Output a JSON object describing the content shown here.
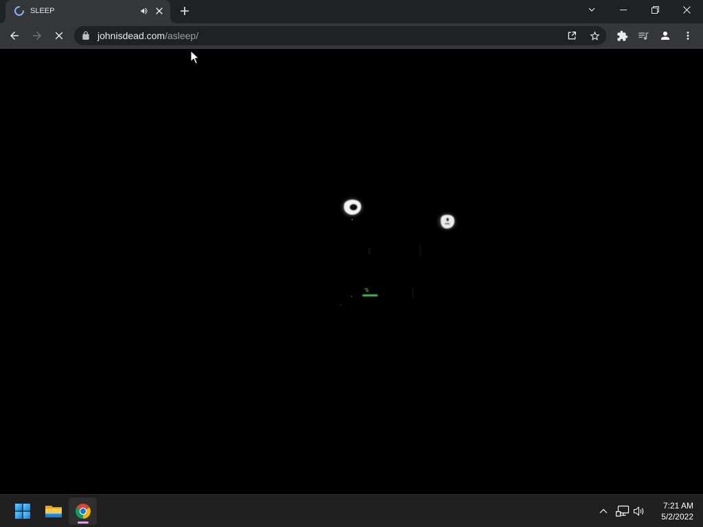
{
  "tabstrip": {
    "tabs": [
      {
        "title": "SLEEP",
        "active": true,
        "loading": true,
        "audio_playing": true,
        "icons": [
          "loading-spinner-icon",
          "audio-playing-icon",
          "close-icon"
        ]
      }
    ],
    "icons": [
      "new-tab-icon",
      "tab-search-icon",
      "minimize-icon",
      "restore-icon",
      "close-icon"
    ]
  },
  "toolbar": {
    "url": {
      "domain": "johnisdead.com",
      "path": "/asleep/"
    },
    "secure": true,
    "back_enabled": true,
    "forward_enabled": false,
    "page_loading": true,
    "icons": {
      "navigation": [
        "back-arrow-icon",
        "forward-arrow-icon",
        "stop-loading-icon"
      ],
      "omnibox": [
        "lock-icon",
        "share-icon",
        "star-icon"
      ],
      "actions": [
        "extensions-icon",
        "media-controls-icon",
        "profile-icon",
        "more-vert-icon"
      ]
    }
  },
  "taskbar": {
    "apps": [
      {
        "icon": "windows-start-icon",
        "running": false
      },
      {
        "icon": "file-explorer-icon",
        "running": false
      },
      {
        "icon": "chrome-icon",
        "running": true,
        "active": true
      }
    ],
    "tray_icons": [
      "chevron-up-icon",
      "network-icon",
      "volume-icon"
    ],
    "clock": {
      "time": "7:21 AM",
      "date": "5/2/2022"
    }
  },
  "colors": {
    "tabstrip_bg": "#202124",
    "toolbar_bg": "#35363a",
    "omnibox_bg": "#202124",
    "icon": "#e8eaed",
    "icon_disabled": "#6f7377",
    "url_domain": "#e8eaed",
    "url_path": "#9aa0a6",
    "spinner": "#8ab4f8",
    "page_bg": "#000000",
    "taskbar_bg": "#202020",
    "taskbar_active_indicator": "#d9a7d9"
  }
}
